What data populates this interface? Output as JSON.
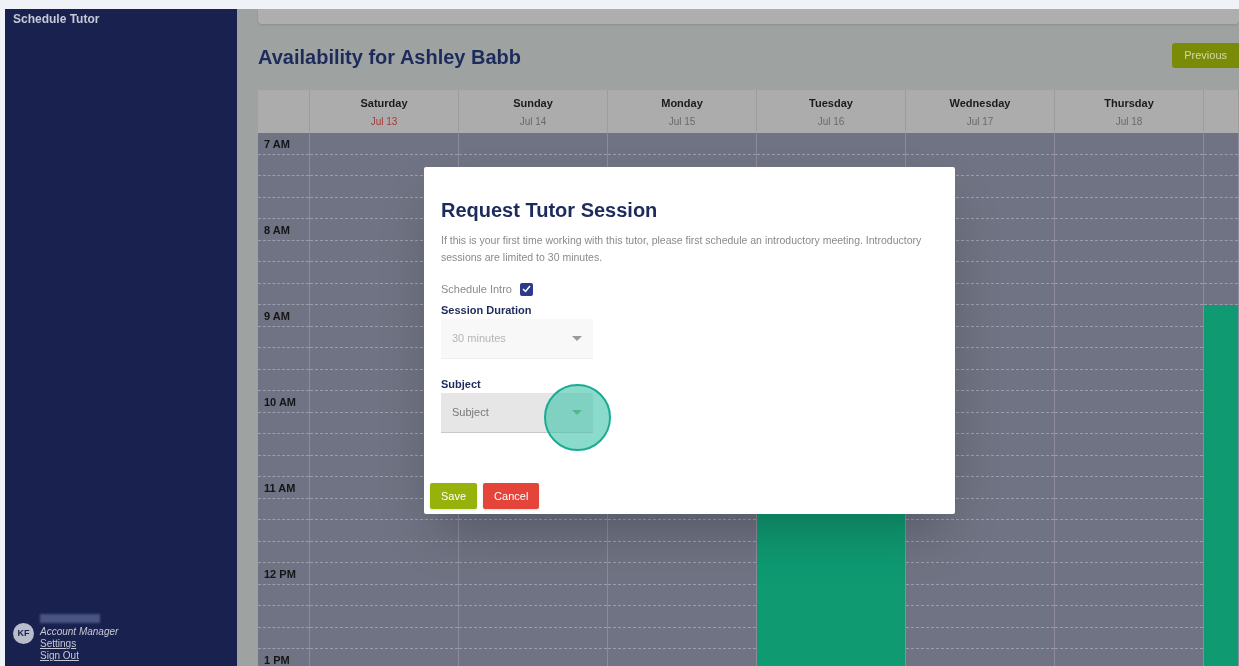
{
  "sidebar": {
    "title": "Schedule Tutor",
    "account": {
      "initials": "KF",
      "role": "Account Manager",
      "links": [
        "Settings",
        "Sign Out"
      ]
    }
  },
  "page": {
    "title": "Availability for Ashley Babb",
    "previous_button": "Previous"
  },
  "calendar": {
    "hours": [
      "7 AM",
      "8 AM",
      "9 AM",
      "10 AM",
      "11 AM",
      "12 PM",
      "1 PM"
    ],
    "days": [
      {
        "name": "Saturday",
        "date": "Jul 13",
        "highlighted": true,
        "slots": [
          false,
          false,
          false,
          false,
          false,
          false,
          false,
          false,
          false,
          false,
          false,
          false,
          false,
          false,
          false,
          false,
          false,
          false,
          false,
          false,
          false,
          false,
          false,
          false,
          false
        ]
      },
      {
        "name": "Sunday",
        "date": "Jul 14",
        "highlighted": false,
        "top_slots": [
          false,
          false
        ],
        "bottom_slots": [
          false,
          false,
          false,
          false,
          false,
          false,
          false,
          false
        ]
      },
      {
        "name": "Monday",
        "date": "Jul 15",
        "highlighted": false,
        "top_slots": [
          false,
          false
        ],
        "bottom_slots": [
          false,
          false,
          false,
          false,
          false,
          false,
          false,
          false
        ]
      },
      {
        "name": "Tuesday",
        "date": "Jul 16",
        "highlighted": false,
        "top_slots": [
          false,
          false
        ],
        "bottom_slots": [
          true,
          true,
          true,
          true,
          true,
          true,
          true,
          true
        ]
      },
      {
        "name": "Wednesday",
        "date": "Jul 17",
        "highlighted": false,
        "slots": [
          false,
          false,
          false,
          false,
          false,
          false,
          false,
          false,
          false,
          false,
          false,
          false,
          false,
          false,
          false,
          false,
          false,
          false,
          false,
          false,
          false,
          false,
          false,
          false,
          false
        ]
      },
      {
        "name": "Thursday",
        "date": "Jul 18",
        "highlighted": false,
        "slots": [
          false,
          false,
          false,
          false,
          false,
          false,
          false,
          false,
          false,
          false,
          false,
          false,
          false,
          false,
          false,
          false,
          false,
          false,
          false,
          false,
          false,
          false,
          false,
          false,
          false
        ]
      },
      {
        "slots": [
          false,
          false,
          false,
          false,
          false,
          false,
          false,
          false,
          true,
          true,
          true,
          true,
          true,
          true,
          true,
          true,
          true,
          true,
          true,
          true,
          true,
          true,
          true,
          true,
          true
        ]
      }
    ]
  },
  "dialog": {
    "title": "Request Tutor Session",
    "message": "If this is your first time working with this tutor, please first schedule an introductory meeting. Introductory sessions are limited to 30 minutes.",
    "schedule_intro": {
      "label": "Schedule Intro",
      "checked": true
    },
    "fields": [
      {
        "label": "Session Duration",
        "value": "30 minutes",
        "disabled": true
      },
      {
        "label": "Subject",
        "placeholder": "Subject",
        "disabled": false
      }
    ],
    "buttons": [
      {
        "label": "Save",
        "kind": "primary"
      },
      {
        "label": "Cancel",
        "kind": "danger"
      }
    ]
  }
}
